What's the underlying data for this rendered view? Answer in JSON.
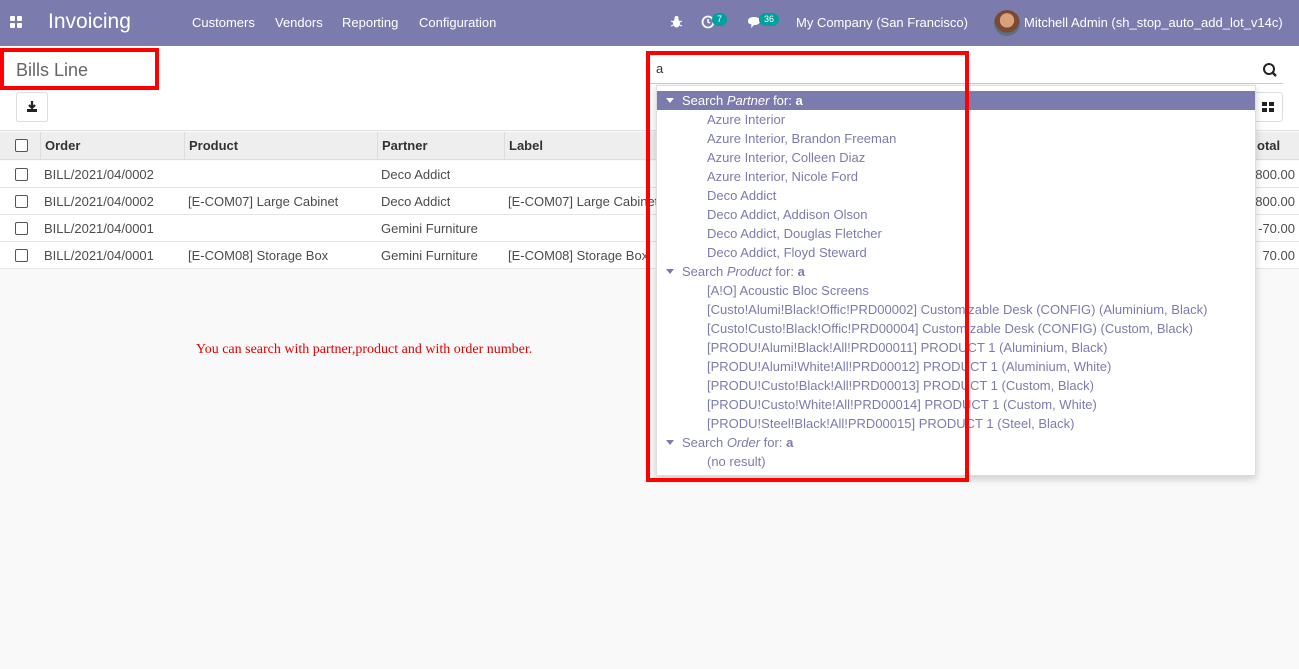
{
  "navbar": {
    "app_name": "Invoicing",
    "menu": [
      "Customers",
      "Vendors",
      "Reporting",
      "Configuration"
    ],
    "activity_count": "7",
    "message_count": "36",
    "company": "My Company (San Francisco)",
    "user": "Mitchell Admin (sh_stop_auto_add_lot_v14c)"
  },
  "control_panel": {
    "title": "Bills Line",
    "search_value": "a"
  },
  "table": {
    "columns": [
      "Order",
      "Product",
      "Partner",
      "Label",
      "Total"
    ],
    "total_header_visible": "otal",
    "rows": [
      {
        "order": "BILL/2021/04/0002",
        "product": "",
        "partner": "Deco Addict",
        "label": "",
        "total": "800.00"
      },
      {
        "order": "BILL/2021/04/0002",
        "product": "[E-COM07] Large Cabinet",
        "partner": "Deco Addict",
        "label": "[E-COM07] Large Cabinet",
        "total": "800.00"
      },
      {
        "order": "BILL/2021/04/0001",
        "product": "",
        "partner": "Gemini Furniture",
        "label": "",
        "total": "-70.00"
      },
      {
        "order": "BILL/2021/04/0001",
        "product": "[E-COM08] Storage Box",
        "partner": "Gemini Furniture",
        "label": "[E-COM08] Storage Box",
        "total": "70.00"
      }
    ]
  },
  "annotation": "You can search with partner,product and with order number.",
  "dropdown": {
    "groups": [
      {
        "prefix": "Search ",
        "field": "Partner",
        "suffix": " for: ",
        "term": "a",
        "items": [
          "Azure Interior",
          "Azure Interior, Brandon Freeman",
          "Azure Interior, Colleen Diaz",
          "Azure Interior, Nicole Ford",
          "Deco Addict",
          "Deco Addict, Addison Olson",
          "Deco Addict, Douglas Fletcher",
          "Deco Addict, Floyd Steward"
        ]
      },
      {
        "prefix": "Search ",
        "field": "Product",
        "suffix": " for: ",
        "term": "a",
        "items": [
          "[A!O] Acoustic Bloc Screens",
          "[Custo!Alumi!Black!Offic!PRD00002] Customizable Desk (CONFIG) (Aluminium, Black)",
          "[Custo!Custo!Black!Offic!PRD00004] Customizable Desk (CONFIG) (Custom, Black)",
          "[PRODU!Alumi!Black!All!PRD00011] PRODUCT 1 (Aluminium, Black)",
          "[PRODU!Alumi!White!All!PRD00012] PRODUCT 1 (Aluminium, White)",
          "[PRODU!Custo!Black!All!PRD00013] PRODUCT 1 (Custom, Black)",
          "[PRODU!Custo!White!All!PRD00014] PRODUCT 1 (Custom, White)",
          "[PRODU!Steel!Black!All!PRD00015] PRODUCT 1 (Steel, Black)"
        ]
      },
      {
        "prefix": "Search ",
        "field": "Order",
        "suffix": " for: ",
        "term": "a",
        "items": [
          "(no result)"
        ]
      }
    ]
  },
  "colors": {
    "navbar": "#7c7bad",
    "highlight": "#ff0000",
    "badge": "#00a09d"
  },
  "icons": [
    "apps-grid-icon",
    "bug-icon",
    "clock-icon",
    "chat-icon",
    "download-icon",
    "search-icon",
    "kanban-view-icon",
    "caret-down-icon"
  ]
}
